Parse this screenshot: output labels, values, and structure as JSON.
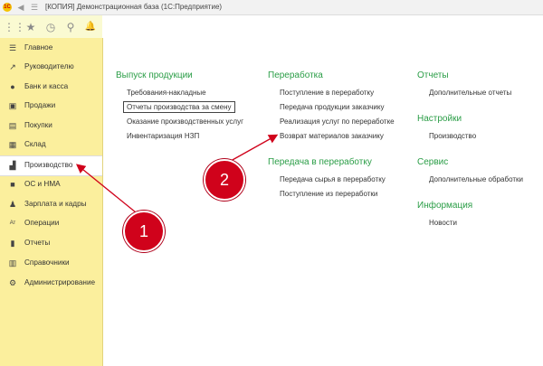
{
  "window": {
    "title": "[КОПИЯ] Демонстрационная база  (1С:Предприятие)",
    "logo_text": "1С"
  },
  "sidebar": {
    "items": [
      {
        "label": "Главное",
        "icon": "menu-lines-icon",
        "glyph": "☰"
      },
      {
        "label": "Руководителю",
        "icon": "trend-chart-icon",
        "glyph": "↗"
      },
      {
        "label": "Банк и касса",
        "icon": "coin-icon",
        "glyph": "●"
      },
      {
        "label": "Продажи",
        "icon": "cart-icon",
        "glyph": "▣"
      },
      {
        "label": "Покупки",
        "icon": "basket-icon",
        "glyph": "▤"
      },
      {
        "label": "Склад",
        "icon": "warehouse-icon",
        "glyph": "▦"
      },
      {
        "label": "Производство",
        "icon": "factory-icon",
        "glyph": "▟",
        "active": true
      },
      {
        "label": "ОС и НМА",
        "icon": "truck-icon",
        "glyph": "■"
      },
      {
        "label": "Зарплата и кадры",
        "icon": "people-icon",
        "glyph": "♟"
      },
      {
        "label": "Операции",
        "icon": "operations-icon",
        "glyph": "Ат"
      },
      {
        "label": "Отчеты",
        "icon": "bar-chart-icon",
        "glyph": "▮"
      },
      {
        "label": "Справочники",
        "icon": "book-icon",
        "glyph": "▥"
      },
      {
        "label": "Администрирование",
        "icon": "gear-icon",
        "glyph": "⚙"
      }
    ]
  },
  "toolbar": {
    "items": [
      {
        "icon": "apps-grid-icon",
        "glyph": "⋮⋮"
      },
      {
        "icon": "star-icon",
        "glyph": "★"
      },
      {
        "icon": "history-icon",
        "glyph": "◷"
      },
      {
        "icon": "search-icon",
        "glyph": "⚲"
      },
      {
        "icon": "bell-icon",
        "glyph": "🔔"
      }
    ]
  },
  "sections": {
    "vypusk": {
      "title": "Выпуск продукции",
      "links": [
        "Требования-накладные",
        "Отчеты производства за смену",
        "Оказание производственных услуг",
        "Инвентаризация НЗП"
      ]
    },
    "pererabotka": {
      "title": "Переработка",
      "links": [
        "Поступление в переработку",
        "Передача продукции заказчику",
        "Реализация услуг по переработке",
        "Возврат материалов заказчику"
      ]
    },
    "peredacha": {
      "title": "Передача в переработку",
      "links": [
        "Передача сырья в переработку",
        "Поступление из переработки"
      ]
    },
    "otchety": {
      "title": "Отчеты",
      "links": [
        "Дополнительные отчеты"
      ]
    },
    "nastroyki": {
      "title": "Настройки",
      "links": [
        "Производство"
      ]
    },
    "servis": {
      "title": "Сервис",
      "links": [
        "Дополнительные обработки"
      ]
    },
    "informaciya": {
      "title": "Информация",
      "links": [
        "Новости"
      ]
    }
  },
  "annotations": {
    "badge1": "1",
    "badge2": "2",
    "accent_color": "#d0021b",
    "section_color": "#2a9d46",
    "sidebar_color": "#fbef9d"
  }
}
